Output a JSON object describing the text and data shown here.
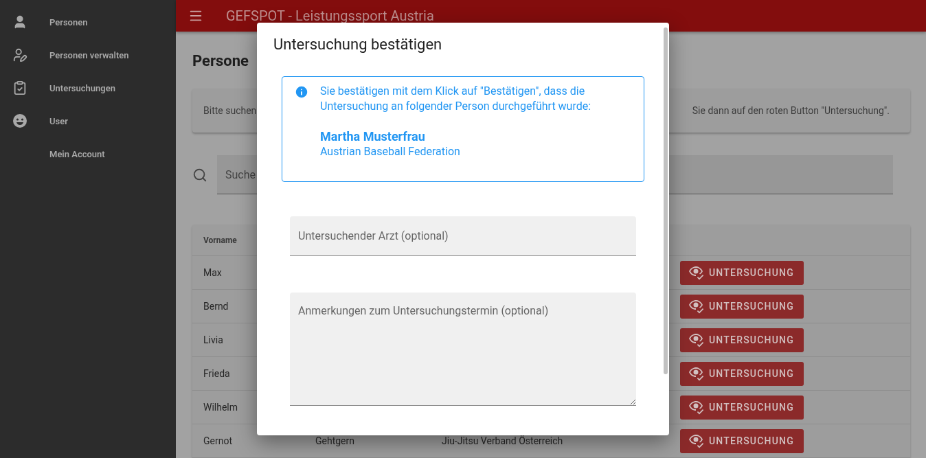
{
  "app_bar": {
    "title": "GEFSPOT - Leistungssport Austria"
  },
  "sidebar": {
    "items": [
      {
        "label": "Personen"
      },
      {
        "label": "Personen verwalten"
      },
      {
        "label": "Untersuchungen"
      },
      {
        "label": "User"
      },
      {
        "label": "Mein Account"
      }
    ]
  },
  "page": {
    "heading": "Persone",
    "hint_start": "Bitte suchen",
    "hint_end": "Sie dann auf den roten Button \"Untersuchung\".",
    "search": {
      "placeholder": "Suche"
    }
  },
  "table": {
    "columns": [
      "Vorname"
    ],
    "rows": [
      {
        "cells": [
          "Max"
        ],
        "action": "UNTERSUCHUNG"
      },
      {
        "cells": [
          "Bernd"
        ],
        "action": "UNTERSUCHUNG"
      },
      {
        "cells": [
          "Livia"
        ],
        "action": "UNTERSUCHUNG"
      },
      {
        "cells": [
          "Frieda"
        ],
        "action": "UNTERSUCHUNG"
      },
      {
        "cells": [
          "Wilhelm"
        ],
        "action": "UNTERSUCHUNG"
      },
      {
        "cells": [
          "Gernot",
          "Gehtgern",
          "Jiu-Jitsu Verband Österreich"
        ],
        "action": "UNTERSUCHUNG"
      }
    ]
  },
  "dialog": {
    "title": "Untersuchung bestätigen",
    "info": {
      "text": "Sie bestätigen mit dem Klick auf \"Bestätigen\", dass die Untersuchung an folgender Person durchgeführt wurde:",
      "name": "Martha Musterfrau",
      "organization": "Austrian Baseball Federation"
    },
    "fields": [
      {
        "kind": "text",
        "placeholder": "Untersuchender Arzt (optional)"
      },
      {
        "kind": "textarea",
        "placeholder": "Anmerkungen zum Untersuchungstermin (optional)"
      }
    ]
  }
}
